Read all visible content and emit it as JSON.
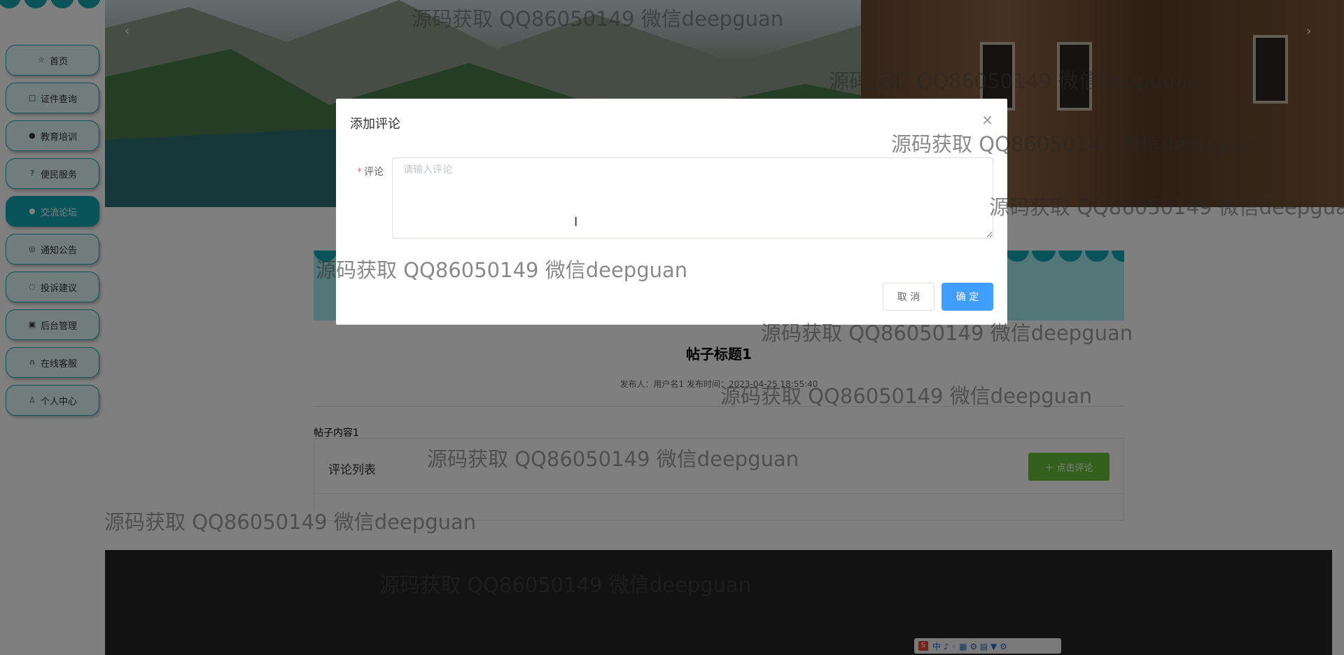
{
  "sidebar": {
    "items": [
      {
        "label": "首页",
        "icon": "star-icon",
        "glyph": "☆",
        "active": false
      },
      {
        "label": "证件查询",
        "icon": "bag-icon",
        "glyph": "□",
        "active": false
      },
      {
        "label": "教育培训",
        "icon": "info-icon",
        "glyph": "●",
        "active": false
      },
      {
        "label": "便民服务",
        "icon": "help-icon",
        "glyph": "?",
        "active": false
      },
      {
        "label": "交流论坛",
        "icon": "info-icon",
        "glyph": "●",
        "active": true
      },
      {
        "label": "通知公告",
        "icon": "smile-icon",
        "glyph": "◎",
        "active": false
      },
      {
        "label": "投诉建议",
        "icon": "check-circle-icon",
        "glyph": "◌",
        "active": false
      },
      {
        "label": "后台管理",
        "icon": "briefcase-icon",
        "glyph": "▣",
        "active": false
      },
      {
        "label": "在线客服",
        "icon": "headset-icon",
        "glyph": "∩",
        "active": false
      },
      {
        "label": "个人中心",
        "icon": "user-icon",
        "glyph": "♙",
        "active": false
      }
    ]
  },
  "banner": {
    "prev_arrow": "‹",
    "next_arrow": "›"
  },
  "post": {
    "title": "帖子标题1",
    "meta": "发布人：用户名1  发布时间：2023-04-25 18:55:40",
    "content": "帖子内容1"
  },
  "comments": {
    "header": "评论列表",
    "add_button": "＋ 点击评论"
  },
  "modal": {
    "title": "添加评论",
    "close": "×",
    "field_required_mark": "*",
    "field_label": "评论",
    "placeholder": "请输入评论",
    "value": "",
    "cancel_label": "取 消",
    "confirm_label": "确 定"
  },
  "ime_toolbar": {
    "logo": "S",
    "items": "中 ♪ ◦ ▦ ⚙ ▤ ▼ ⚙"
  },
  "watermark": "源码获取 QQ86050149 微信deepguan",
  "colors": {
    "accent": "#13a8b4",
    "primary_button": "#409eff",
    "success_button": "#67c23a",
    "required": "#f56c6c"
  }
}
